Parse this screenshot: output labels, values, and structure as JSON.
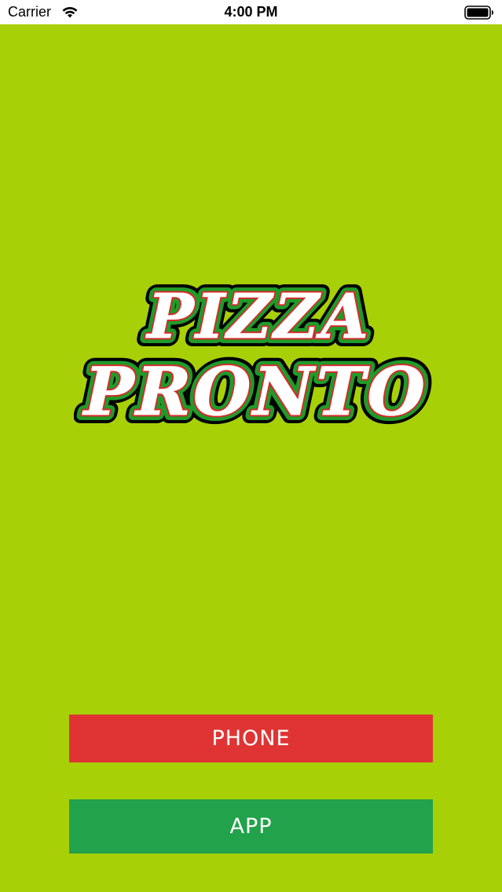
{
  "status_bar": {
    "carrier": "Carrier",
    "time": "4:00 PM",
    "wifi_icon": "wifi-icon",
    "battery_icon": "battery-icon"
  },
  "logo": {
    "line1": "PIZZA",
    "line2": "PRONTO"
  },
  "buttons": {
    "phone_label": "PHONE",
    "app_label": "APP"
  },
  "colors": {
    "background": "#a8d007",
    "phone_button": "#e03434",
    "app_button": "#22a24a",
    "logo_green": "#1f9b2a",
    "logo_red": "#d62a2a",
    "logo_black": "#000000"
  }
}
